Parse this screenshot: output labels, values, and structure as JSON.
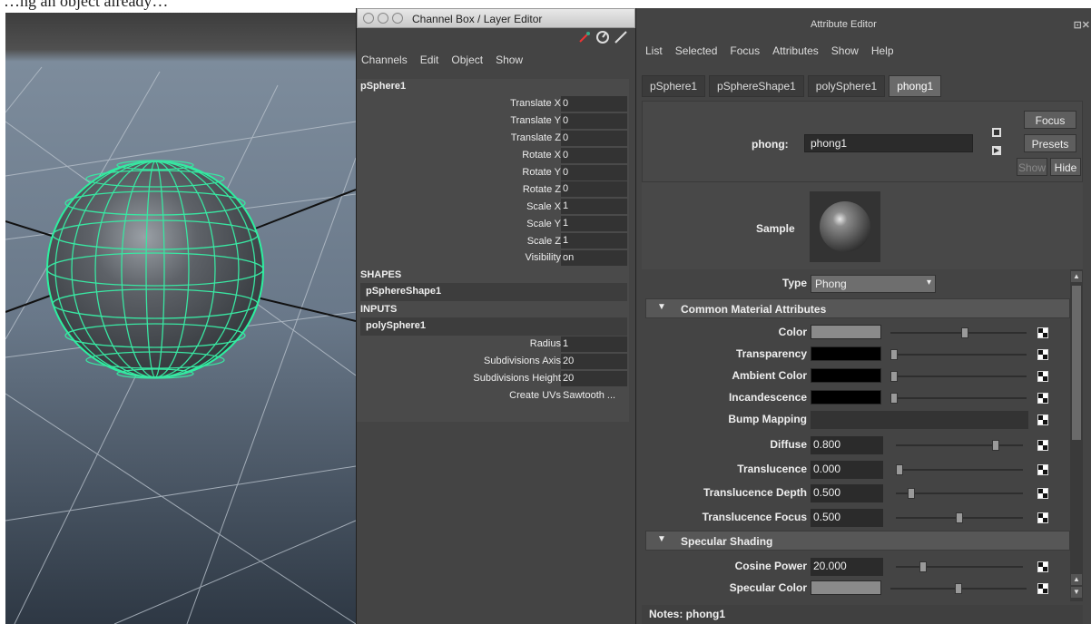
{
  "caption": "…ng an object already…",
  "channel_box": {
    "title": "Channel Box / Layer Editor",
    "menu": [
      "Channels",
      "Edit",
      "Object",
      "Show"
    ],
    "object": "pSphere1",
    "channels": [
      {
        "label": "Translate X",
        "value": "0"
      },
      {
        "label": "Translate Y",
        "value": "0"
      },
      {
        "label": "Translate Z",
        "value": "0"
      },
      {
        "label": "Rotate X",
        "value": "0"
      },
      {
        "label": "Rotate Y",
        "value": "0"
      },
      {
        "label": "Rotate Z",
        "value": "0"
      },
      {
        "label": "Scale X",
        "value": "1"
      },
      {
        "label": "Scale Y",
        "value": "1"
      },
      {
        "label": "Scale Z",
        "value": "1"
      },
      {
        "label": "Visibility",
        "value": "on"
      }
    ],
    "shapes_header": "SHAPES",
    "shape": "pSphereShape1",
    "inputs_header": "INPUTS",
    "input": "polySphere1",
    "input_channels": [
      {
        "label": "Radius",
        "value": "1"
      },
      {
        "label": "Subdivisions Axis",
        "value": "20"
      },
      {
        "label": "Subdivisions Height",
        "value": "20"
      },
      {
        "label": "Create UVs",
        "value": "Sawtooth ..."
      }
    ]
  },
  "attribute_editor": {
    "title": "Attribute Editor",
    "menu": [
      "List",
      "Selected",
      "Focus",
      "Attributes",
      "Show",
      "Help"
    ],
    "tabs": [
      "pSphere1",
      "pSphereShape1",
      "polySphere1",
      "phong1"
    ],
    "active_tab": 3,
    "node_label": "phong:",
    "node_value": "phong1",
    "buttons": {
      "focus": "Focus",
      "presets": "Presets",
      "show": "Show",
      "hide": "Hide"
    },
    "sample_label": "Sample",
    "type_label": "Type",
    "type_value": "Phong",
    "common_section": "Common Material Attributes",
    "specular_section": "Specular Shading",
    "color_rows": [
      {
        "label": "Color",
        "swatch": "#8a8a8a",
        "slider": 0.55
      },
      {
        "label": "Transparency",
        "swatch": "#000000",
        "slider": 0.0
      },
      {
        "label": "Ambient Color",
        "swatch": "#000000",
        "slider": 0.0
      },
      {
        "label": "Incandescence",
        "swatch": "#000000",
        "slider": 0.0
      }
    ],
    "bump_label": "Bump Mapping",
    "numeric_rows": [
      {
        "label": "Diffuse",
        "value": "0.800",
        "slider": 0.8
      },
      {
        "label": "Translucence",
        "value": "0.000",
        "slider": 0.0
      },
      {
        "label": "Translucence Depth",
        "value": "0.500",
        "slider": 0.1
      },
      {
        "label": "Translucence Focus",
        "value": "0.500",
        "slider": 0.5
      }
    ],
    "cosine_power": {
      "label": "Cosine Power",
      "value": "20.000",
      "slider": 0.2
    },
    "specular_color": {
      "label": "Specular Color",
      "swatch": "#8a8a8a",
      "slider": 0.5
    },
    "notes": "Notes:  phong1"
  }
}
